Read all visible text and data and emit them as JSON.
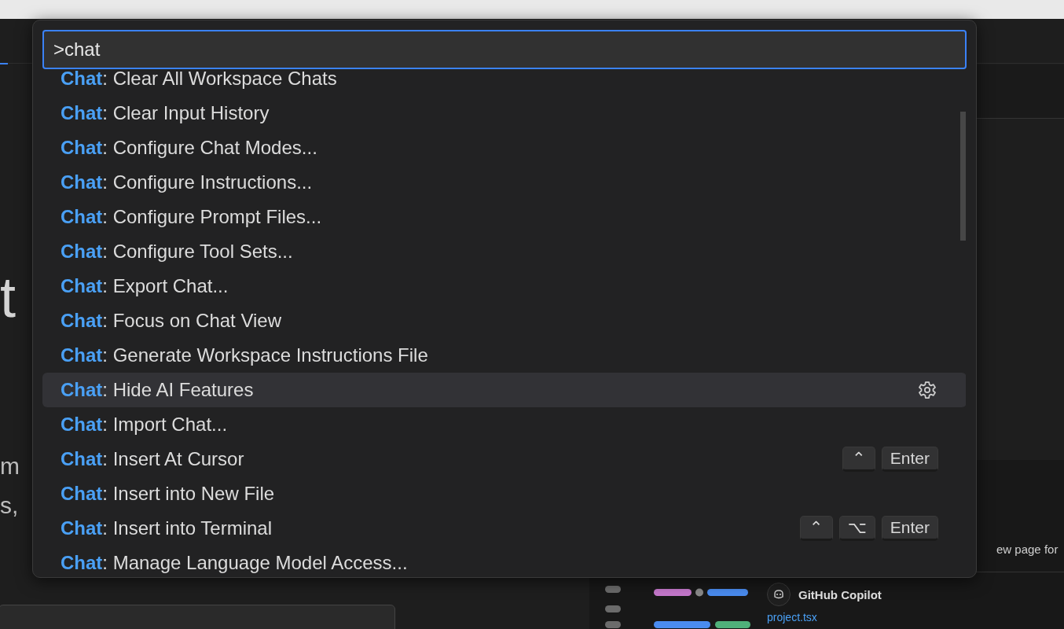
{
  "background": {
    "fragments": [
      {
        "kind": "big",
        "text": "t"
      },
      {
        "kind": "small",
        "text": "m"
      },
      {
        "kind": "small",
        "text": "s,"
      }
    ],
    "preview_text": "ew page for",
    "chat_author": "GitHub Copilot",
    "file_link": "project.tsx"
  },
  "palette": {
    "query": ">chat",
    "items": [
      {
        "prefix": "Chat",
        "rest": ": Clear All Workspace Chats",
        "selected": false,
        "gear": false
      },
      {
        "prefix": "Chat",
        "rest": ": Clear Input History",
        "selected": false,
        "gear": false
      },
      {
        "prefix": "Chat",
        "rest": ": Configure Chat Modes...",
        "selected": false,
        "gear": false
      },
      {
        "prefix": "Chat",
        "rest": ": Configure Instructions...",
        "selected": false,
        "gear": false
      },
      {
        "prefix": "Chat",
        "rest": ": Configure Prompt Files...",
        "selected": false,
        "gear": false
      },
      {
        "prefix": "Chat",
        "rest": ": Configure Tool Sets...",
        "selected": false,
        "gear": false
      },
      {
        "prefix": "Chat",
        "rest": ": Export Chat...",
        "selected": false,
        "gear": false
      },
      {
        "prefix": "Chat",
        "rest": ": Focus on Chat View",
        "selected": false,
        "gear": false
      },
      {
        "prefix": "Chat",
        "rest": ": Generate Workspace Instructions File",
        "selected": false,
        "gear": false
      },
      {
        "prefix": "Chat",
        "rest": ": Hide AI Features",
        "selected": true,
        "gear": true
      },
      {
        "prefix": "Chat",
        "rest": ": Import Chat...",
        "selected": false,
        "gear": false
      },
      {
        "prefix": "Chat",
        "rest": ": Insert At Cursor",
        "selected": false,
        "gear": false,
        "keys": [
          "⌃",
          "Enter"
        ]
      },
      {
        "prefix": "Chat",
        "rest": ": Insert into New File",
        "selected": false,
        "gear": false
      },
      {
        "prefix": "Chat",
        "rest": ": Insert into Terminal",
        "selected": false,
        "gear": false,
        "keys": [
          "⌃",
          "⌥",
          "Enter"
        ]
      },
      {
        "prefix": "Chat",
        "rest": ": Manage Language Model Access...",
        "selected": false,
        "gear": false
      }
    ]
  }
}
